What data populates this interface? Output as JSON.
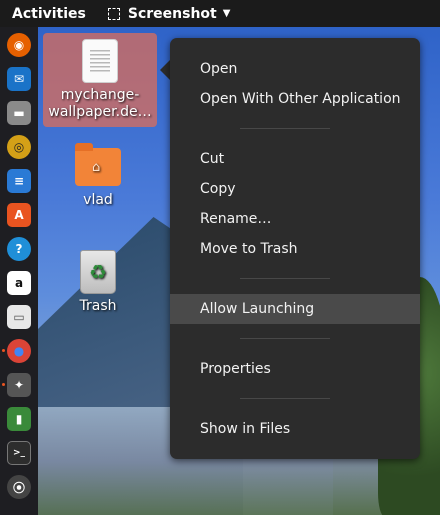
{
  "topbar": {
    "activities": "Activities",
    "app_menu": "Screenshot"
  },
  "dock": {
    "items": [
      {
        "name": "firefox-icon",
        "color": "#e66000",
        "glyph": "◉"
      },
      {
        "name": "thunderbird-icon",
        "color": "#1a73c8",
        "glyph": "✉"
      },
      {
        "name": "files-icon",
        "color": "#7a7a7a",
        "glyph": "▬"
      },
      {
        "name": "rhythmbox-icon",
        "color": "#d4a017",
        "glyph": "◎"
      },
      {
        "name": "writer-icon",
        "color": "#2a7ad5",
        "glyph": "≡"
      },
      {
        "name": "software-icon",
        "color": "#e95420",
        "glyph": "A"
      },
      {
        "name": "help-icon",
        "color": "#1f8fd8",
        "glyph": "?"
      },
      {
        "name": "amazon-icon",
        "color": "#ffffff",
        "glyph": "a"
      },
      {
        "name": "text-editor-icon",
        "color": "#e8e8e8",
        "glyph": "▭"
      },
      {
        "name": "chrome-icon",
        "color": "#db4437",
        "glyph": "●"
      },
      {
        "name": "satellite-icon",
        "color": "#555555",
        "glyph": "✦"
      },
      {
        "name": "system-monitor-icon",
        "color": "#3a8a3a",
        "glyph": "▮"
      },
      {
        "name": "terminal-icon",
        "color": "#2d2d2d",
        "glyph": ">_"
      },
      {
        "name": "app-grid-icon",
        "color": "#444444",
        "glyph": "⦿"
      }
    ]
  },
  "desktop": {
    "icons": [
      {
        "label": "mychange-wallpaper.de…",
        "type": "document"
      },
      {
        "label": "vlad",
        "type": "home-folder"
      },
      {
        "label": "Trash",
        "type": "trash"
      }
    ]
  },
  "context_menu": {
    "items": [
      {
        "label": "Open"
      },
      {
        "label": "Open With Other Application"
      },
      {
        "label": "Cut"
      },
      {
        "label": "Copy"
      },
      {
        "label": "Rename…"
      },
      {
        "label": "Move to Trash"
      },
      {
        "label": "Allow Launching"
      },
      {
        "label": "Properties"
      },
      {
        "label": "Show in Files"
      }
    ],
    "highlighted": "Allow Launching"
  }
}
